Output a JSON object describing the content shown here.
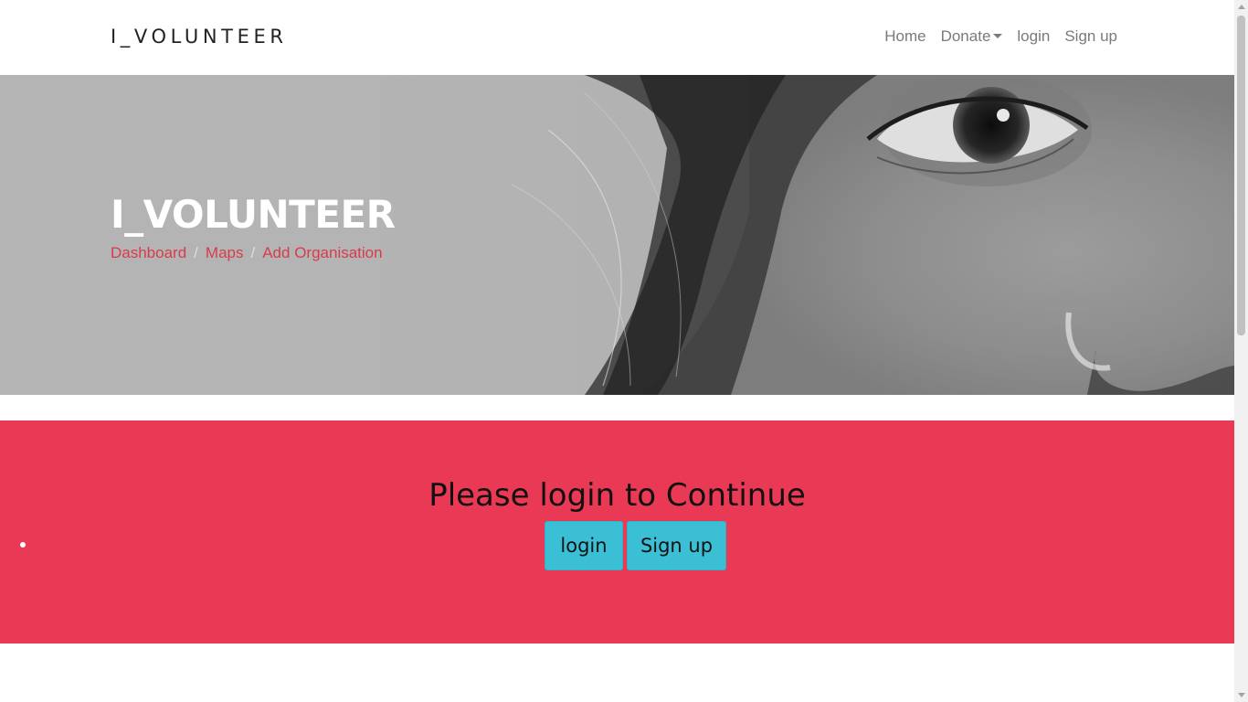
{
  "navbar": {
    "brand": "I_VOLUNTEER",
    "links": {
      "home": "Home",
      "donate": "Donate",
      "login": "login",
      "signup": "Sign up"
    }
  },
  "hero": {
    "title": "I_VOLUNTEER",
    "breadcrumb": [
      "Dashboard",
      "Maps",
      "Add Organisation"
    ],
    "separator": "/"
  },
  "cta": {
    "heading": "Please login to Continue",
    "login_label": "login",
    "signup_label": "Sign up",
    "background": "#ea3954",
    "button_color": "#3bbfd4"
  },
  "icons": [
    "chevron-down-icon",
    "bullet-icon",
    "scroll-up-icon",
    "scroll-down-icon"
  ]
}
